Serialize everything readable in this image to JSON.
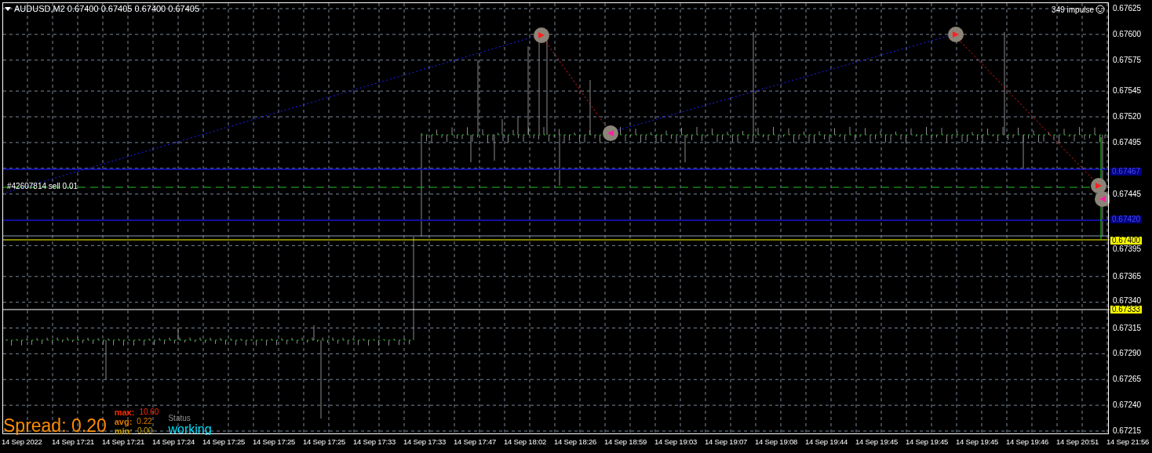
{
  "header": {
    "text": "AUDUSD,M2  0.67400 0.67405 0.67400 0.67405"
  },
  "indicator": {
    "text": "349 impulse"
  },
  "order": {
    "text": "#42607814 sell 0.01"
  },
  "price_axis": {
    "ticks": [
      "0.67625",
      "0.67600",
      "0.67575",
      "0.67545",
      "0.67520",
      "0.67495",
      "0.67445",
      "0.67395",
      "0.67365",
      "0.67340",
      "0.67315",
      "0.67290",
      "0.67265",
      "0.67240",
      "0.67215"
    ],
    "tags": [
      {
        "text": "0.67467",
        "color": "#000080"
      },
      {
        "text": "0.67420",
        "color": "#000080"
      },
      {
        "text": "0.67400",
        "color": "#ffff00"
      },
      {
        "text": "0.67333",
        "color": "#ffff00"
      }
    ]
  },
  "time_axis": {
    "labels": [
      "14 Sep 2022",
      "14 Sep 17:21",
      "14 Sep 17:21",
      "14 Sep 17:24",
      "14 Sep 17:25",
      "14 Sep 17:25",
      "14 Sep 17:25",
      "14 Sep 17:33",
      "14 Sep 17:33",
      "14 Sep 17:47",
      "14 Sep 18:02",
      "14 Sep 18:26",
      "14 Sep 18:59",
      "14 Sep 19:03",
      "14 Sep 19:07",
      "14 Sep 19:08",
      "14 Sep 19:44",
      "14 Sep 19:45",
      "14 Sep 19:45",
      "14 Sep 19:45",
      "14 Sep 19:46",
      "14 Sep 20:51",
      "14 Sep 21:56"
    ]
  },
  "spread": {
    "label": "Spread: 0.20",
    "stats": [
      {
        "name": "max:",
        "value": "10.60",
        "color": "#ff2a00"
      },
      {
        "name": "avg:",
        "value": "0.22",
        "color": "#e07800"
      },
      {
        "name": "min:",
        "value": "0.00",
        "color": "#c8a000"
      }
    ]
  },
  "status": {
    "label": "Status",
    "value": "working"
  }
}
